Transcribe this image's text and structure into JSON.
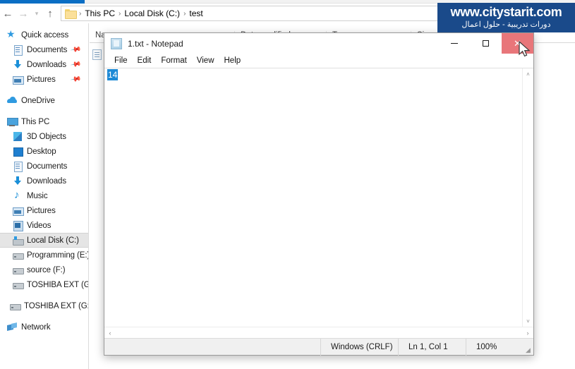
{
  "window": {
    "app": "File Explorer"
  },
  "explorer": {
    "nav": {
      "back_icon": "back-arrow-icon",
      "forward_icon": "forward-arrow-icon",
      "recent_icon": "chevron-down-icon",
      "up_icon": "up-arrow-icon"
    },
    "address": {
      "folder_icon": "folder-icon",
      "separator": "›",
      "crumbs": [
        "This PC",
        "Local Disk (C:)",
        "test"
      ],
      "dropdown_icon": "chevron-down-icon",
      "refresh_icon": "refresh-icon"
    },
    "columns": [
      {
        "label": "Name"
      },
      {
        "label": "Date modified"
      },
      {
        "label": "Type"
      },
      {
        "label": "Size"
      }
    ],
    "sidebar": [
      {
        "label": "Quick access",
        "icon": "star-icon",
        "indent": 0,
        "pinned": false,
        "selected": false
      },
      {
        "label": "Documents",
        "icon": "document-icon",
        "indent": 1,
        "pinned": true,
        "selected": false
      },
      {
        "label": "Downloads",
        "icon": "download-icon",
        "indent": 1,
        "pinned": true,
        "selected": false
      },
      {
        "label": "Pictures",
        "icon": "pictures-icon",
        "indent": 1,
        "pinned": true,
        "selected": false
      },
      {
        "label": "OneDrive",
        "icon": "cloud-icon",
        "indent": 0,
        "pinned": false,
        "selected": false
      },
      {
        "label": "This PC",
        "icon": "computer-icon",
        "indent": 0,
        "pinned": false,
        "selected": false
      },
      {
        "label": "3D Objects",
        "icon": "3d-objects-icon",
        "indent": 1,
        "pinned": false,
        "selected": false
      },
      {
        "label": "Desktop",
        "icon": "desktop-icon",
        "indent": 1,
        "pinned": false,
        "selected": false
      },
      {
        "label": "Documents",
        "icon": "document-icon",
        "indent": 1,
        "pinned": false,
        "selected": false
      },
      {
        "label": "Downloads",
        "icon": "download-icon",
        "indent": 1,
        "pinned": false,
        "selected": false
      },
      {
        "label": "Music",
        "icon": "music-icon",
        "indent": 1,
        "pinned": false,
        "selected": false
      },
      {
        "label": "Pictures",
        "icon": "pictures-icon",
        "indent": 1,
        "pinned": false,
        "selected": false
      },
      {
        "label": "Videos",
        "icon": "videos-icon",
        "indent": 1,
        "pinned": false,
        "selected": false
      },
      {
        "label": "Local Disk (C:)",
        "icon": "local-disk-icon",
        "indent": 1,
        "pinned": false,
        "selected": true
      },
      {
        "label": "Programming (E:)",
        "icon": "drive-icon",
        "indent": 1,
        "pinned": false,
        "selected": false
      },
      {
        "label": "source (F:)",
        "icon": "drive-icon",
        "indent": 1,
        "pinned": false,
        "selected": false
      },
      {
        "label": "TOSHIBA EXT (G:)",
        "icon": "drive-icon",
        "indent": 1,
        "pinned": false,
        "selected": false
      },
      {
        "label": "TOSHIBA EXT (G:)",
        "icon": "drive-icon",
        "indent": 0,
        "pinned": false,
        "selected": false
      },
      {
        "label": "Network",
        "icon": "network-icon",
        "indent": 0,
        "pinned": false,
        "selected": false
      }
    ]
  },
  "notepad": {
    "title": "1.txt - Notepad",
    "app_icon": "notepad-icon",
    "menu": [
      "File",
      "Edit",
      "Format",
      "View",
      "Help"
    ],
    "document_text": "14",
    "window_controls": {
      "minimize": "minimize-icon",
      "maximize": "maximize-icon",
      "close": "close-icon"
    },
    "status": {
      "encoding": "Windows (CRLF)",
      "position": "Ln 1, Col 1",
      "zoom": "100%"
    },
    "scroll": {
      "up_arrow": "˄",
      "down_arrow": "˅",
      "left_arrow": "‹",
      "right_arrow": "›"
    }
  },
  "watermark": {
    "title": "www.citystarit.com",
    "subtitle": "دورات تدريبية - حلول اعمال",
    "background_color": "#1a4a8a",
    "text_color": "#ffffff"
  },
  "colors": {
    "accent": "#0b6ec4",
    "selection": "#1e8ad6",
    "close_hover": "#e8767a"
  }
}
